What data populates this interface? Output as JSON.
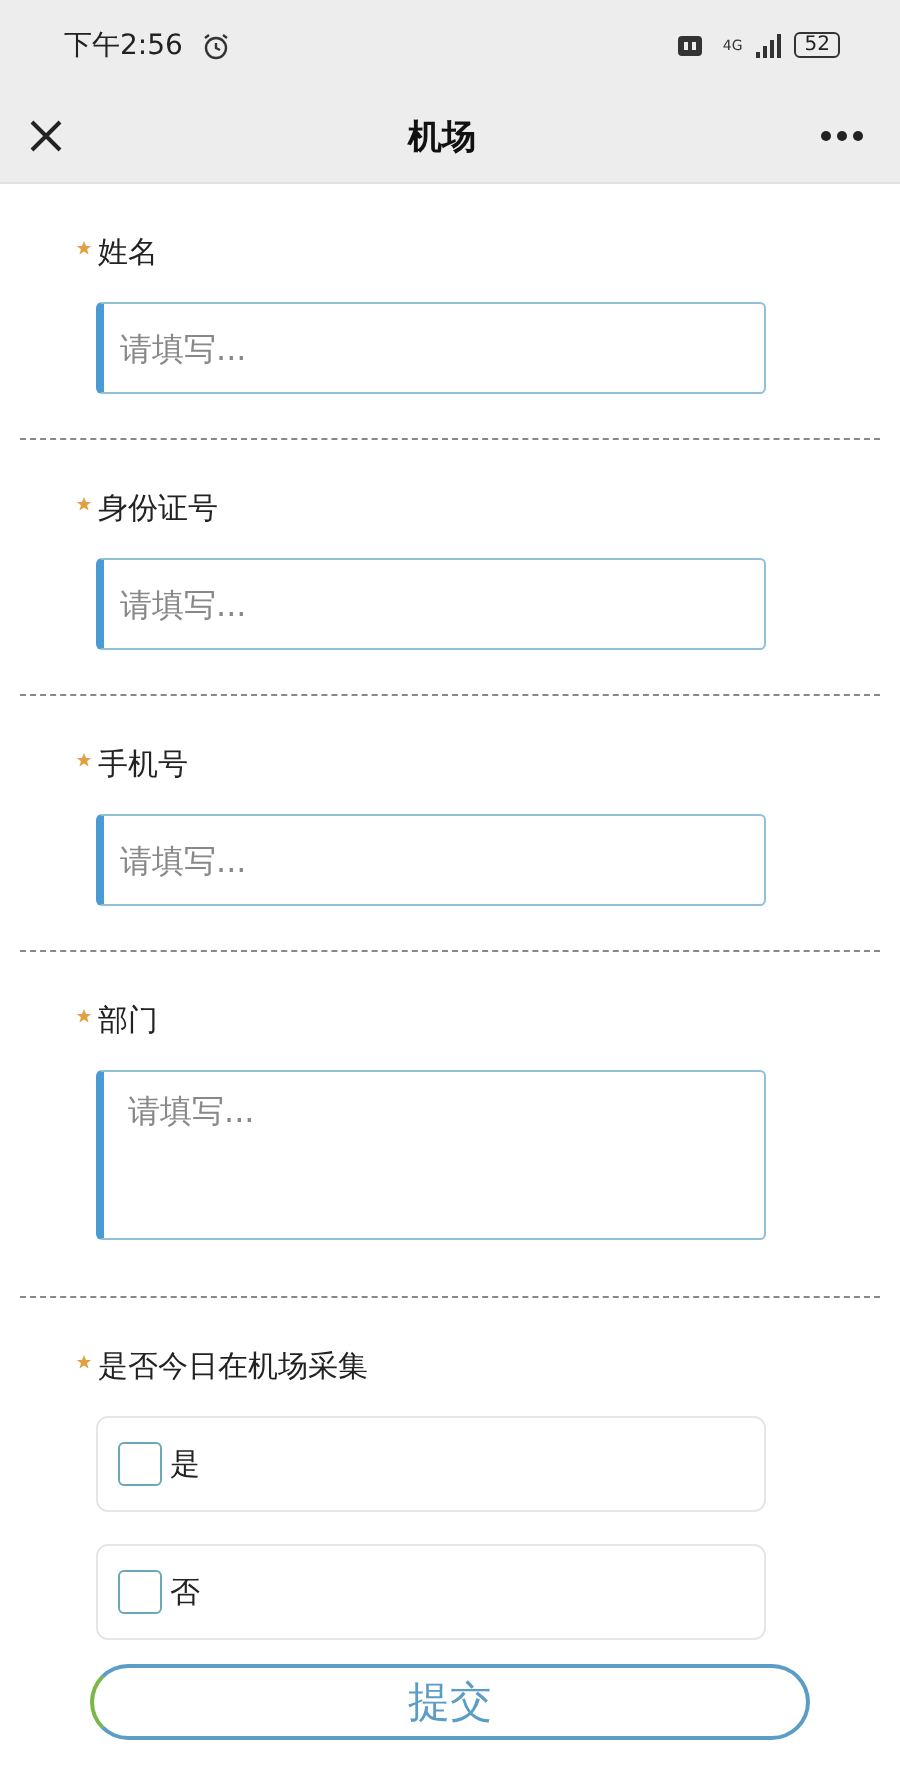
{
  "status_bar": {
    "time": "下午2:56",
    "network": "4G",
    "battery": "52"
  },
  "nav": {
    "title": "机场"
  },
  "fields": [
    {
      "kind": "text",
      "label": "姓名",
      "required": true,
      "placeholder": "请填写..."
    },
    {
      "kind": "text",
      "label": "身份证号",
      "required": true,
      "placeholder": "请填写..."
    },
    {
      "kind": "text",
      "label": "手机号",
      "required": true,
      "placeholder": "请填写..."
    },
    {
      "kind": "textarea",
      "label": "部门",
      "required": true,
      "placeholder": "请填写..."
    }
  ],
  "question": {
    "label": "是否今日在机场采集",
    "required": true,
    "options": [
      {
        "label": "是",
        "checked": false
      },
      {
        "label": "否",
        "checked": false
      }
    ]
  },
  "submit": "提交"
}
